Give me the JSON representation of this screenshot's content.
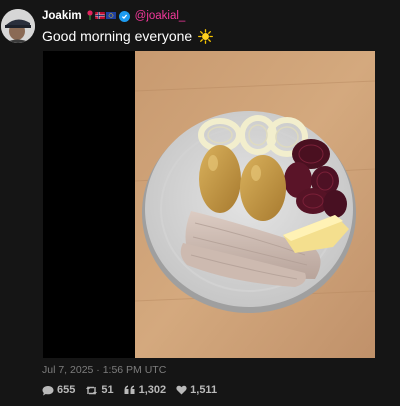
{
  "author": {
    "display_name": "Joakim",
    "handle": "@joakial_",
    "flag_icons": [
      "rose-icon",
      "norway-flag-icon",
      "eu-flag-icon"
    ],
    "verified_icon": "verified-badge-icon"
  },
  "tweet": {
    "text": "Good morning everyone",
    "emoji_icon": "sun-icon",
    "timestamp": "Jul 7, 2025 · 1:56 PM UTC"
  },
  "stats": {
    "replies": "655",
    "retweets": "51",
    "quotes": "1,302",
    "likes": "1,511"
  },
  "colors": {
    "background": "#151515",
    "handle": "#f2389a",
    "verified": "#1d9bf0",
    "muted_text": "#7d7d7d"
  }
}
